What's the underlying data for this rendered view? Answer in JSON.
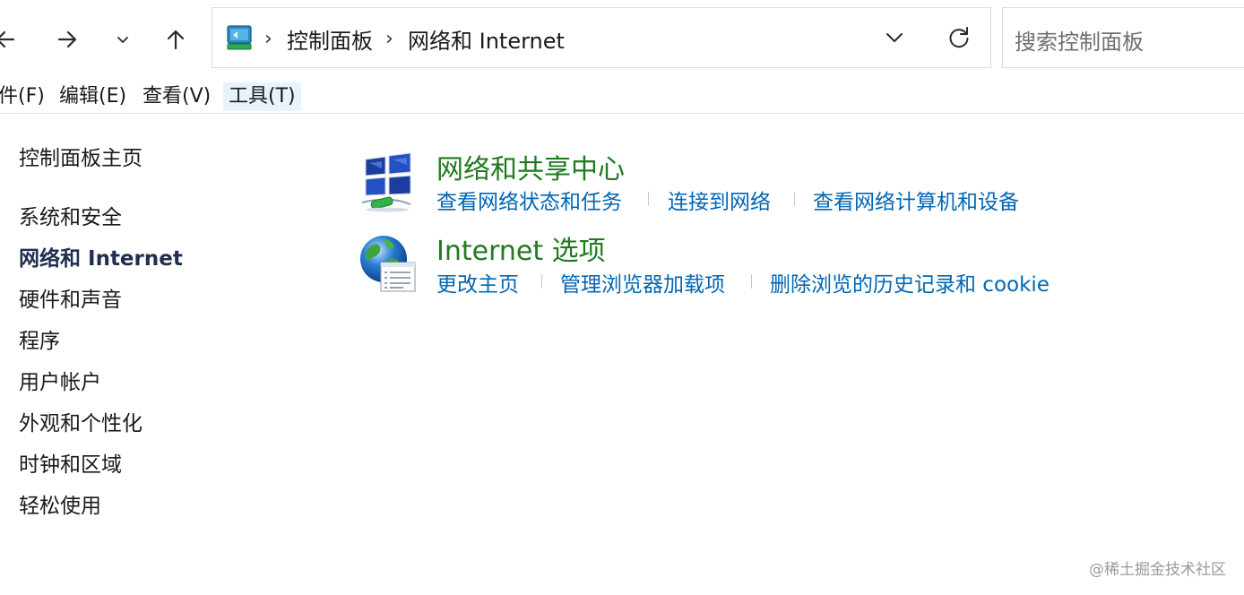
{
  "nav": {
    "back_icon": "arrow-left-icon",
    "forward_icon": "arrow-right-icon",
    "recent_icon": "chevron-down-icon",
    "up_icon": "arrow-up-icon"
  },
  "address": {
    "icon": "control-panel-icon",
    "separator": "›",
    "crumbs": [
      "控制面板",
      "网络和 Internet"
    ],
    "dropdown_icon": "chevron-down-icon",
    "refresh_icon": "refresh-icon"
  },
  "search": {
    "placeholder": "搜索控制面板"
  },
  "menubar": {
    "items": [
      "件(F)",
      "编辑(E)",
      "查看(V)",
      "工具(T)"
    ],
    "active": "工具(T)"
  },
  "sidebar": {
    "home": "控制面板主页",
    "items": [
      "系统和安全",
      "网络和 Internet",
      "硬件和声音",
      "程序",
      "用户帐户",
      "外观和个性化",
      "时钟和区域",
      "轻松使用"
    ],
    "current": "网络和 Internet"
  },
  "categories": [
    {
      "icon": "network-sharing-center-icon",
      "title": "网络和共享中心",
      "tasks": [
        "查看网络状态和任务",
        "连接到网络",
        "查看网络计算机和设备"
      ]
    },
    {
      "icon": "internet-options-icon",
      "title": "Internet 选项",
      "tasks": [
        "更改主页",
        "管理浏览器加载项",
        "删除浏览的历史记录和 cookie"
      ]
    }
  ],
  "colors": {
    "title_green": "#1f7a1f",
    "link_blue": "#0066b4",
    "menu_active_bg": "#e8f2fb"
  },
  "watermark": "@稀土掘金技术社区"
}
